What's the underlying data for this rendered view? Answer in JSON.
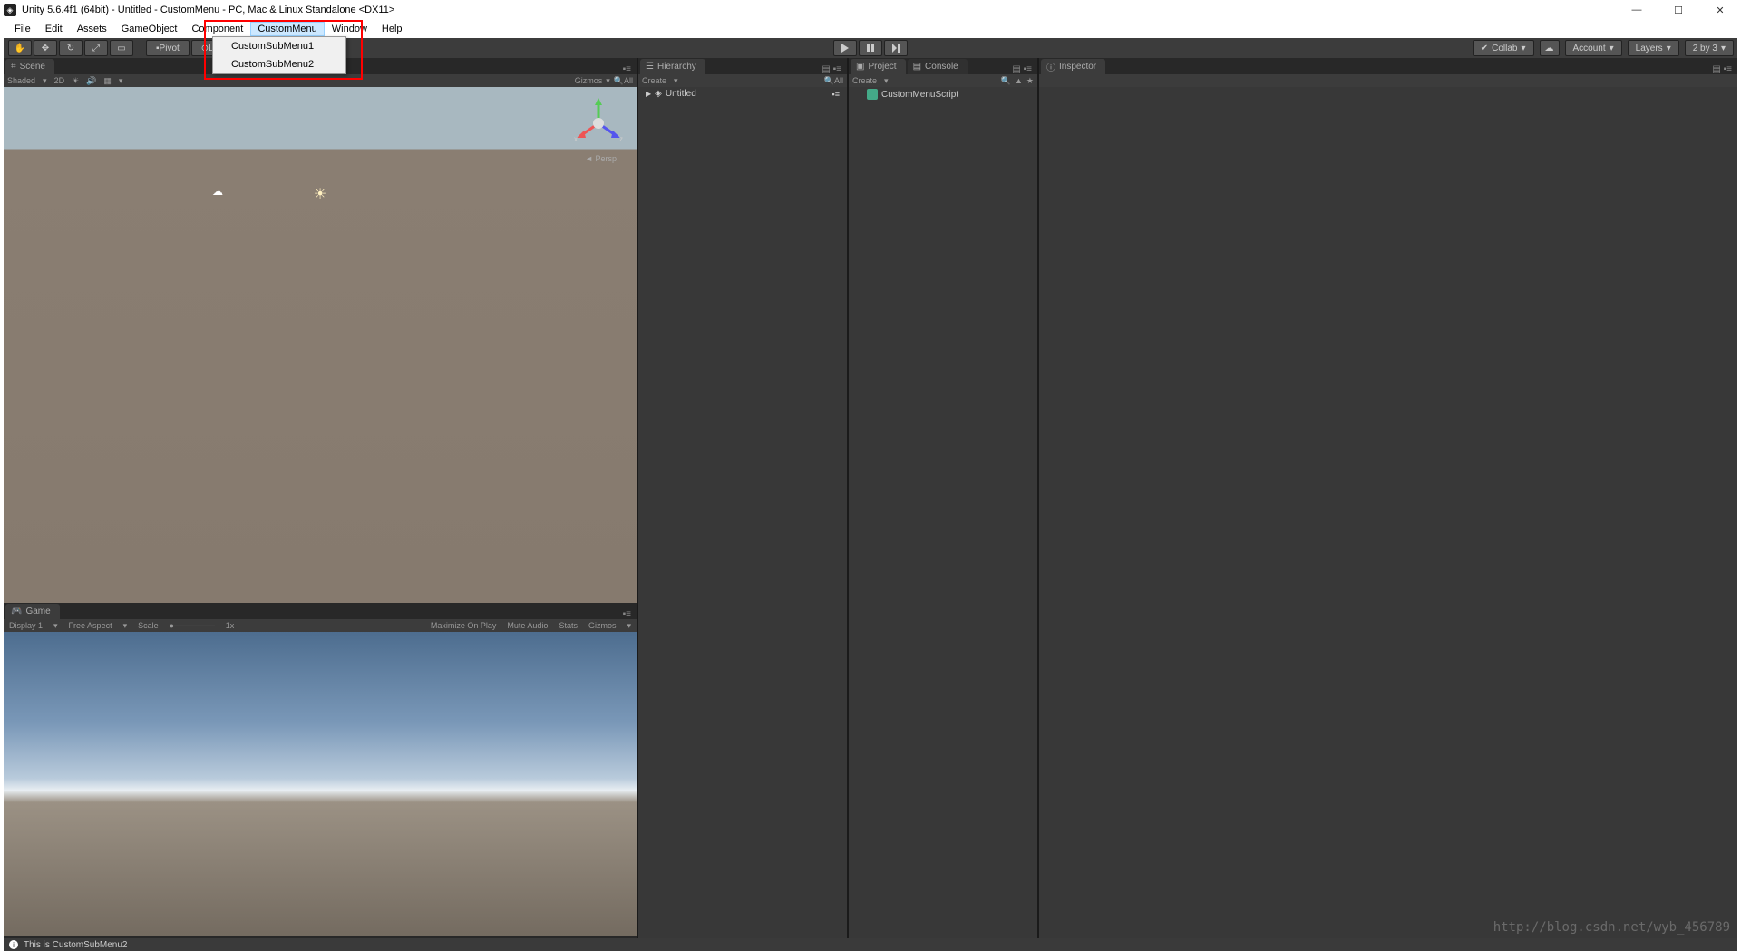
{
  "titlebar": {
    "title": "Unity 5.6.4f1 (64bit) - Untitled - CustomMenu - PC, Mac & Linux Standalone <DX11>"
  },
  "menubar": {
    "items": [
      "File",
      "Edit",
      "Assets",
      "GameObject",
      "Component",
      "CustomMenu",
      "Window",
      "Help"
    ]
  },
  "dropdown": {
    "items": [
      "CustomSubMenu1",
      "CustomSubMenu2"
    ]
  },
  "toolbar": {
    "pivot": "Pivot",
    "local": "Local",
    "collab": "Collab",
    "account": "Account",
    "layers": "Layers",
    "layout": "2 by 3"
  },
  "scene": {
    "tab": "Scene",
    "shaded": "Shaded",
    "mode2d": "2D",
    "gizmos": "Gizmos",
    "all": "All",
    "persp": "Persp",
    "axes": {
      "x": "x",
      "y": "y",
      "z": "z"
    }
  },
  "game": {
    "tab": "Game",
    "display": "Display 1",
    "aspect": "Free Aspect",
    "scale": "Scale",
    "scaleVal": "1x",
    "maximize": "Maximize On Play",
    "mute": "Mute Audio",
    "stats": "Stats",
    "gizmos": "Gizmos"
  },
  "hierarchy": {
    "tab": "Hierarchy",
    "create": "Create",
    "all": "All",
    "root": "Untitled"
  },
  "project": {
    "tab": "Project",
    "consoleTab": "Console",
    "create": "Create",
    "items": [
      "CustomMenuScript"
    ]
  },
  "inspector": {
    "tab": "Inspector"
  },
  "statusbar": {
    "message": "This is CustomSubMenu2"
  },
  "watermark": "http://blog.csdn.net/wyb_456789"
}
